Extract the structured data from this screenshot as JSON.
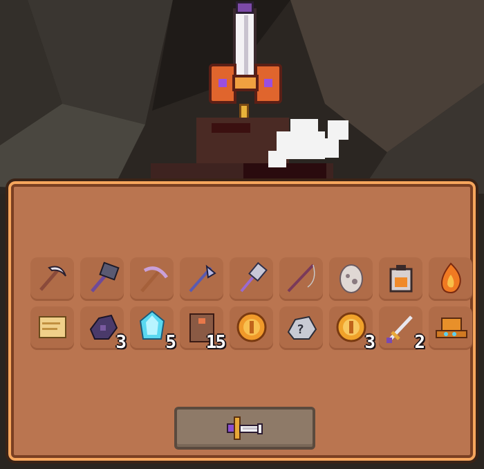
{
  "scene": {
    "forge_sword_icon": "forge-sword-icon",
    "anvil_icon": "anvil-icon",
    "smoke_icon": "smoke-puff-icon"
  },
  "inventory": {
    "rows": [
      [
        {
          "icon": "scythe-icon",
          "count": ""
        },
        {
          "icon": "hammer-icon",
          "count": ""
        },
        {
          "icon": "pickaxe-icon",
          "count": ""
        },
        {
          "icon": "halberd-icon",
          "count": ""
        },
        {
          "icon": "mace-icon",
          "count": ""
        },
        {
          "icon": "fishing-rod-icon",
          "count": ""
        },
        {
          "icon": "egg-icon",
          "count": ""
        },
        {
          "icon": "lantern-icon",
          "count": ""
        },
        {
          "icon": "fire-essence-icon",
          "count": ""
        }
      ],
      [
        {
          "icon": "scroll-icon",
          "count": ""
        },
        {
          "icon": "dark-ore-icon",
          "count": "3"
        },
        {
          "icon": "blue-crystal-icon",
          "count": "5"
        },
        {
          "icon": "book-icon",
          "count": "15"
        },
        {
          "icon": "gold-coin-icon",
          "count": ""
        },
        {
          "icon": "mystery-ore-icon",
          "count": ""
        },
        {
          "icon": "gold-coin-stack-icon",
          "count": "3"
        },
        {
          "icon": "sword-icon",
          "count": "2"
        },
        {
          "icon": "hat-icon",
          "count": ""
        }
      ]
    ]
  },
  "action_button": {
    "icon": "forge-sword-icon"
  },
  "colors": {
    "panel": "#ba7550",
    "panel_border": "#f6a65d",
    "slot": "#b06c48",
    "button": "#8e7a68"
  }
}
